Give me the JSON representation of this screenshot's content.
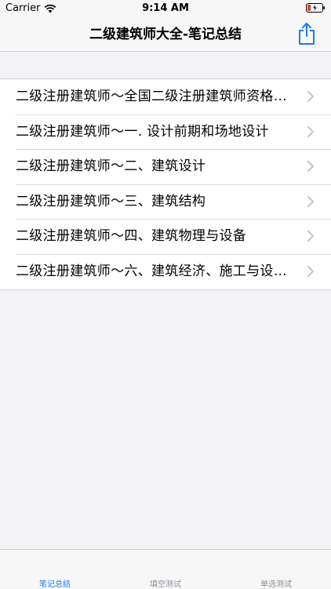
{
  "status_bar": {
    "carrier": "Carrier",
    "time": "9:14 AM"
  },
  "nav": {
    "title": "二级建筑师大全-笔记总结"
  },
  "list": {
    "items": [
      {
        "label": "二级注册建筑师～全国二级注册建筑师资格…"
      },
      {
        "label": "二级注册建筑师～一. 设计前期和场地设计"
      },
      {
        "label": "二级注册建筑师～二、建筑设计"
      },
      {
        "label": "二级注册建筑师～三、建筑结构"
      },
      {
        "label": "二级注册建筑师～四、建筑物理与设备"
      },
      {
        "label": "二级注册建筑师～六、建筑经济、施工与设…"
      }
    ]
  },
  "tabs": [
    {
      "label": "笔记总结",
      "active": true
    },
    {
      "label": "填空测试",
      "active": false
    },
    {
      "label": "单选测试",
      "active": false
    }
  ],
  "colors": {
    "accent": "#1a7fe8",
    "battery_low": "#e5393a",
    "background": "#f2f2f7"
  },
  "icons": {
    "share": "share-icon",
    "chevron": "chevron-right-icon",
    "wifi": "wifi-icon",
    "battery": "battery-icon"
  }
}
